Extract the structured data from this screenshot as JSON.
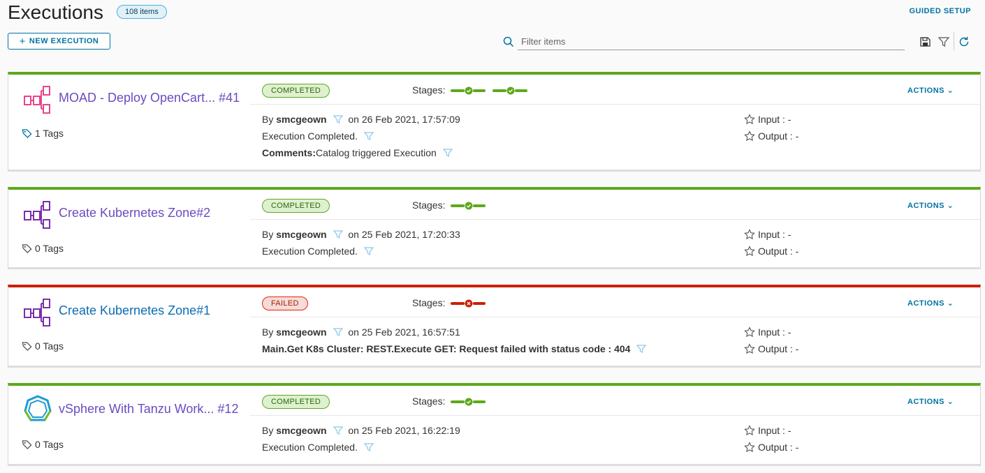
{
  "header": {
    "title": "Executions",
    "count_badge": "108 items",
    "guided_setup": "GUIDED SETUP",
    "new_execution": "NEW EXECUTION",
    "filter_placeholder": "Filter items"
  },
  "labels": {
    "stages": "Stages:",
    "actions": "ACTIONS",
    "by": "By",
    "input": "Input : -",
    "output": "Output : -"
  },
  "executions": [
    {
      "name": "MOAD - Deploy OpenCart... #41",
      "tags": "1 Tags",
      "status": "COMPLETED",
      "user": "smcgeown",
      "date": "on 26 Feb 2021, 17:57:09",
      "message": "Execution Completed.",
      "comments_label": "Comments:",
      "comments": "Catalog triggered Execution",
      "stages": [
        "success",
        "success"
      ],
      "icon": "pipeline-icon"
    },
    {
      "name": "Create Kubernetes Zone#2",
      "tags": "0 Tags",
      "status": "COMPLETED",
      "user": "smcgeown",
      "date": "on 25 Feb 2021, 17:20:33",
      "message": "Execution Completed.",
      "stages": [
        "success"
      ],
      "icon": "pipeline-icon"
    },
    {
      "name": "Create Kubernetes Zone#1",
      "tags": "0 Tags",
      "status": "FAILED",
      "user": "smcgeown",
      "date": "on 25 Feb 2021, 16:57:51",
      "message": "Main.Get K8s Cluster: REST.Execute GET: Request failed with status code : 404",
      "stages": [
        "failed"
      ],
      "icon": "pipeline-icon"
    },
    {
      "name": "vSphere With Tanzu Work... #12",
      "tags": "0 Tags",
      "status": "COMPLETED",
      "user": "smcgeown",
      "date": "on 25 Feb 2021, 16:22:19",
      "message": "Execution Completed.",
      "stages": [
        "success"
      ],
      "icon": "tanzu-icon"
    }
  ],
  "colors": {
    "success": "#5ea81c",
    "failed": "#c92100",
    "link": "#0072a3",
    "pipeline_pink": "#e8458b",
    "pipeline_purple": "#7b2fa8",
    "tanzu_blue": "#1d9ad6"
  }
}
